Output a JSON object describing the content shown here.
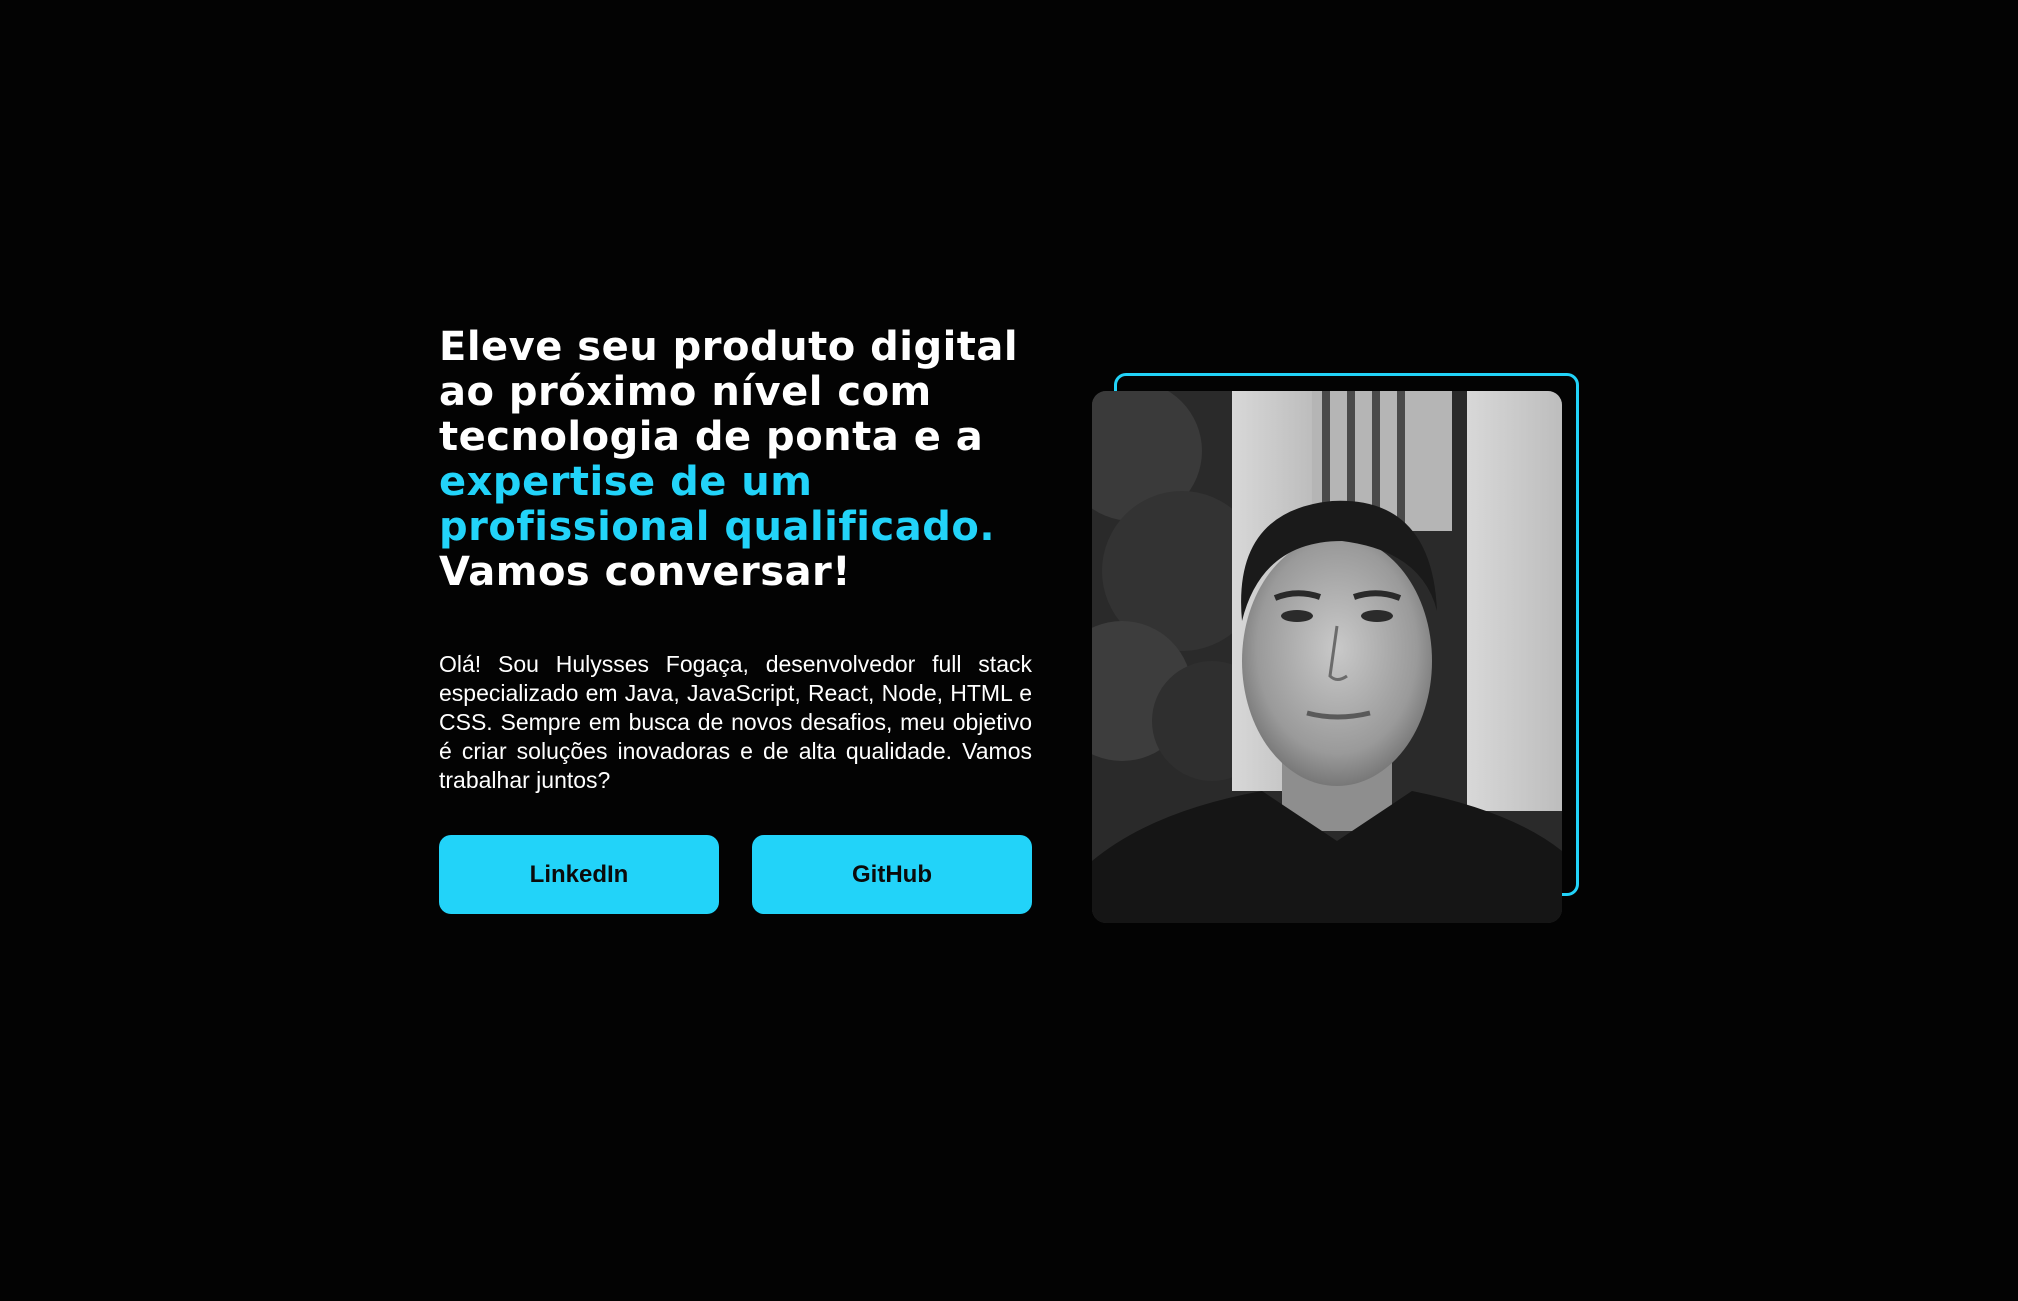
{
  "hero": {
    "headline_part1": "Eleve seu produto digital ao próximo nível com tecnologia de ponta e a ",
    "headline_accent": "expertise de um profissional qualificado.",
    "headline_part2": " Vamos conversar!",
    "bio": "Olá! Sou Hulysses Fogaça, desenvolvedor full stack especializado em Java, JavaScript, React, Node, HTML e CSS. Sempre em busca de novos desafios, meu objetivo é criar soluções inovadoras e de alta qualidade. Vamos trabalhar juntos?",
    "buttons": {
      "linkedin_label": "LinkedIn",
      "github_label": "GitHub"
    }
  },
  "photo": {
    "alt": "portrait-photo"
  },
  "colors": {
    "background": "#030303",
    "accent": "#22d3f9",
    "text": "#ffffff"
  }
}
